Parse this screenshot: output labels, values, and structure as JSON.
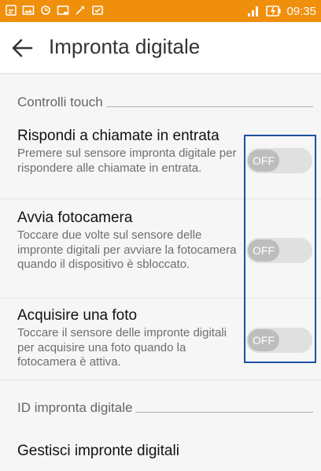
{
  "status_bar": {
    "time": "09:35",
    "icons": [
      "notification-icon",
      "gallery-icon",
      "sync-icon",
      "cast-icon",
      "tools-icon",
      "download-icon",
      "signal-icon",
      "battery-charging-icon"
    ]
  },
  "header": {
    "title": "Impronta digitale",
    "back_icon": "back-arrow-icon"
  },
  "sections": {
    "touch_controls": "Controlli touch",
    "fingerprint_id": "ID impronta digitale"
  },
  "settings": [
    {
      "title": "Rispondi a chiamate in entrata",
      "summary": "Premere sul sensore impronta digitale per rispondere alle chiamate in entrata.",
      "toggle_state": "OFF"
    },
    {
      "title": "Avvia fotocamera",
      "summary": "Toccare due volte sul sensore delle impronte digitali per avviare la fotocamera quando il dispositivo è sbloccato.",
      "toggle_state": "OFF"
    },
    {
      "title": "Acquisire una foto",
      "summary": "Toccare il sensore delle impronte digitali per acquisire una foto quando la fotocamera è attiva.",
      "toggle_state": "OFF"
    }
  ],
  "menu": {
    "manage_fingerprints": "Gestisci impronte digitali"
  },
  "colors": {
    "status_bar": "#f08f0b",
    "highlight": "#1f4fa0"
  }
}
